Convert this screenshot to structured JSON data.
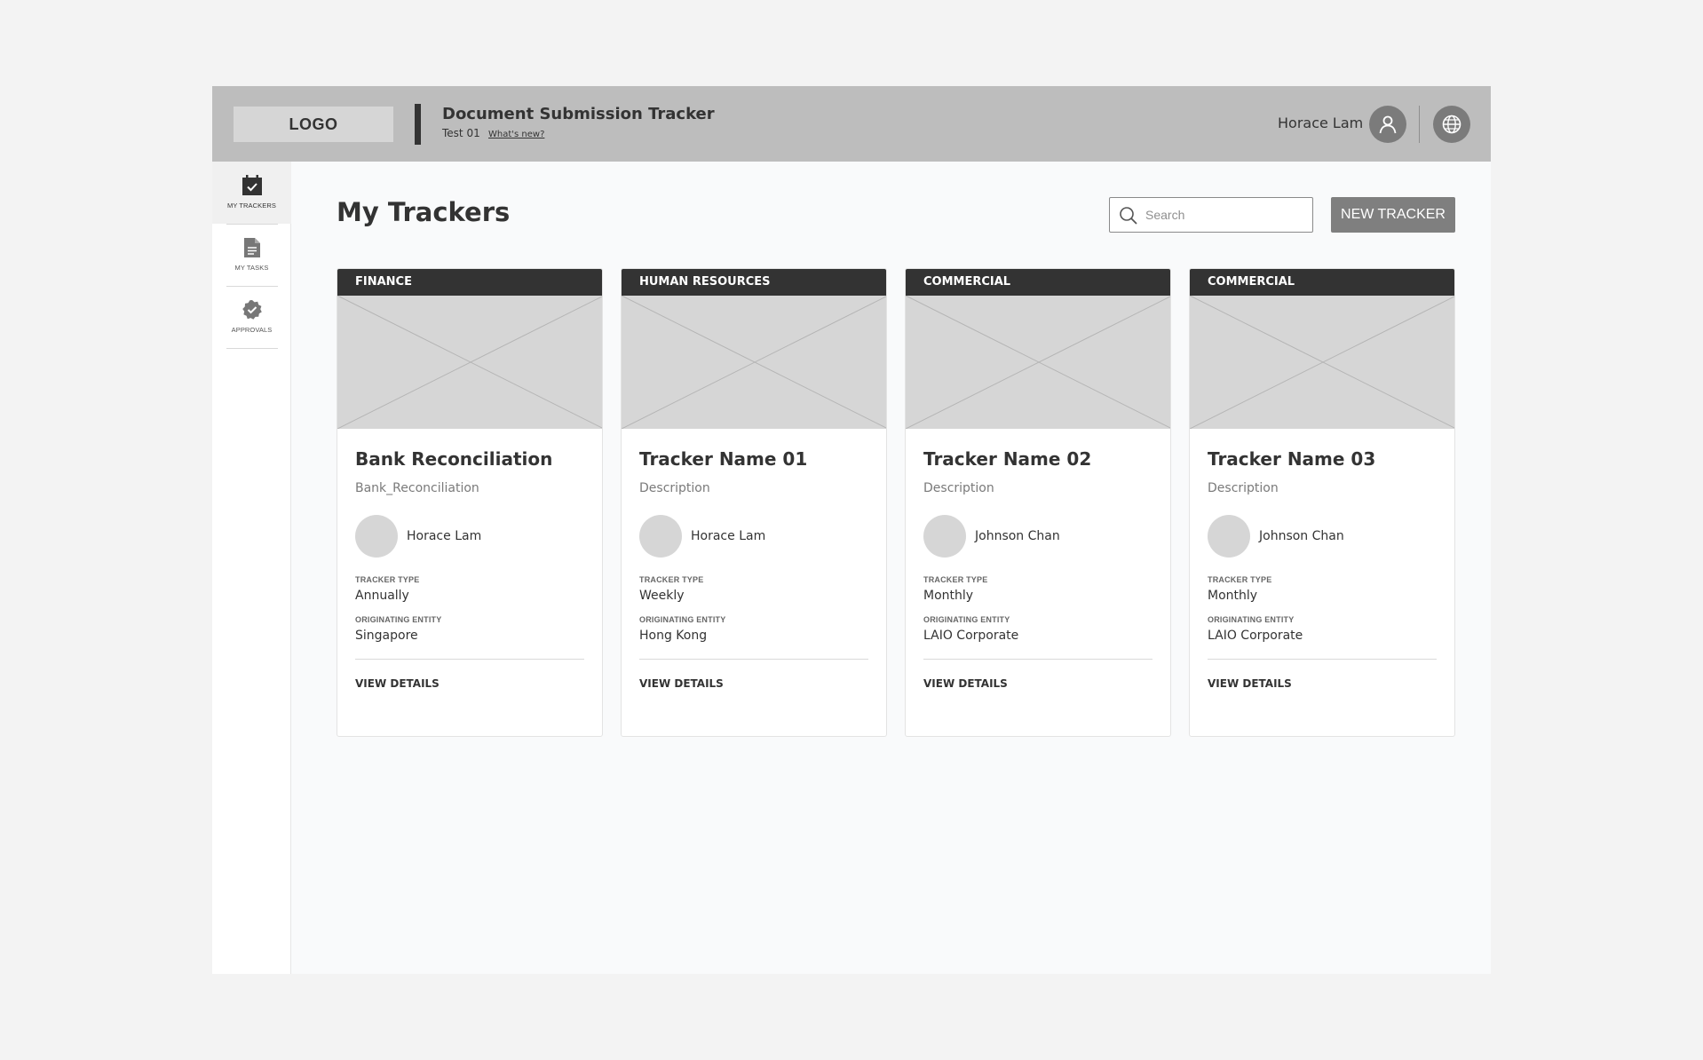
{
  "header": {
    "logo_text": "LOGO",
    "app_title": "Document Submission Tracker",
    "app_subtitle": "Test 01",
    "whats_new": "What's new?",
    "user_name": "Horace Lam",
    "user_icon": "user-icon",
    "language_icon": "globe-icon"
  },
  "sidebar": {
    "items": [
      {
        "label": "MY TRACKERS",
        "icon": "calendar-check-icon",
        "active": true
      },
      {
        "label": "MY TASKS",
        "icon": "document-icon",
        "active": false
      },
      {
        "label": "APPROVALS",
        "icon": "badge-check-icon",
        "active": false
      }
    ]
  },
  "main": {
    "title": "My Trackers",
    "search_placeholder": "Search",
    "new_tracker_label": "NEW TRACKER"
  },
  "cards": [
    {
      "category": "FINANCE",
      "name": "Bank Reconciliation",
      "description": "Bank_Reconciliation",
      "owner": "Horace Lam",
      "type_label": "TRACKER TYPE",
      "type_value": "Annually",
      "entity_label": "ORIGINATING ENTITY",
      "entity_value": "Singapore",
      "action": "VIEW DETAILS"
    },
    {
      "category": "HUMAN RESOURCES",
      "name": "Tracker Name 01",
      "description": "Description",
      "owner": "Horace Lam",
      "type_label": "TRACKER TYPE",
      "type_value": "Weekly",
      "entity_label": "ORIGINATING ENTITY",
      "entity_value": "Hong Kong",
      "action": "VIEW DETAILS"
    },
    {
      "category": "COMMERCIAL",
      "name": "Tracker Name 02",
      "description": "Description",
      "owner": "Johnson Chan",
      "type_label": "TRACKER TYPE",
      "type_value": "Monthly",
      "entity_label": "ORIGINATING ENTITY",
      "entity_value": "LAIO Corporate",
      "action": "VIEW DETAILS"
    },
    {
      "category": "COMMERCIAL",
      "name": "Tracker Name 03",
      "description": "Description",
      "owner": "Johnson Chan",
      "type_label": "TRACKER TYPE",
      "type_value": "Monthly",
      "entity_label": "ORIGINATING ENTITY",
      "entity_value": "LAIO Corporate",
      "action": "VIEW DETAILS"
    }
  ],
  "colors": {
    "header_bg": "#bdbdbd",
    "category_bar": "#333333",
    "button_bg": "#7f7f7f",
    "placeholder_bg": "#d6d6d6"
  }
}
